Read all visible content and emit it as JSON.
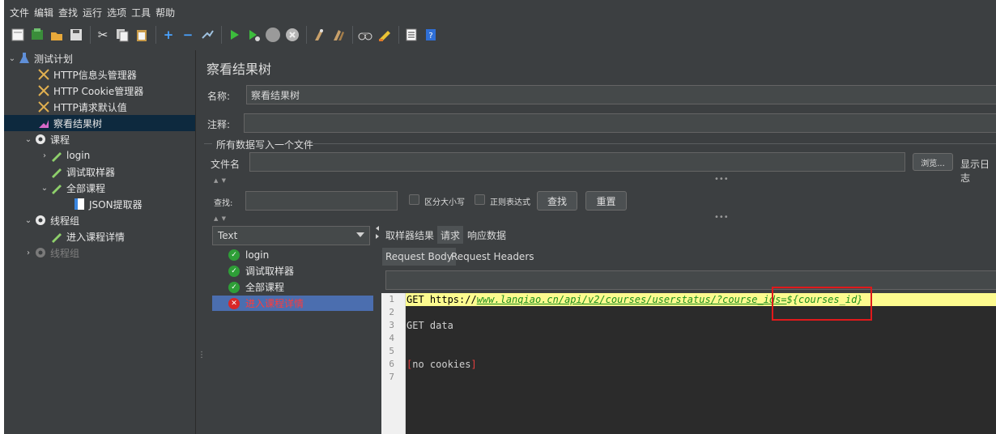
{
  "menubar": [
    "文件",
    "编辑",
    "查找",
    "运行",
    "选项",
    "工具",
    "帮助"
  ],
  "tree": {
    "root": "测试计划",
    "items": [
      {
        "label": "HTTP信息头管理器"
      },
      {
        "label": "HTTP Cookie管理器"
      },
      {
        "label": "HTTP请求默认值"
      },
      {
        "label": "察看结果树"
      },
      {
        "label": "课程"
      },
      {
        "label": "login"
      },
      {
        "label": "调试取样器"
      },
      {
        "label": "全部课程"
      },
      {
        "label": "JSON提取器"
      },
      {
        "label": "线程组"
      },
      {
        "label": "进入课程详情"
      },
      {
        "label": "线程组"
      }
    ]
  },
  "panel": {
    "title": "察看结果树",
    "name_label": "名称:",
    "name_value": "察看结果树",
    "comment_label": "注释:",
    "comment_value": "",
    "log_group_title": "所有数据写入一个文件",
    "filename_label": "文件名",
    "filename_value": "",
    "browse_label": "浏览...",
    "show_log_label": "显示日志",
    "search_label": "查找:",
    "search_value": "",
    "case_label": "区分大小写",
    "regex_label": "正则表达式",
    "find_button": "查找",
    "reset_button": "重置"
  },
  "results": {
    "renderer": "Text",
    "items": [
      {
        "label": "login",
        "status": "ok"
      },
      {
        "label": "调试取样器",
        "status": "ok"
      },
      {
        "label": "全部课程",
        "status": "ok"
      },
      {
        "label": "进入课程详情",
        "status": "fail"
      }
    ]
  },
  "tabs": {
    "main": [
      "取样器结果",
      "请求",
      "响应数据"
    ],
    "active_main": "请求",
    "sub": [
      "Request Body",
      "Request Headers"
    ],
    "active_sub": "Request Body"
  },
  "code": {
    "line_numbers": [
      "1",
      "2",
      "3",
      "4",
      "5",
      "6",
      "7"
    ],
    "line1_prefix": "GET https://",
    "line1_url": "www.lanqiao.cn/api/v2/courses/userstatus/?course_ids=",
    "line1_var": "${courses_id}",
    "line3": "GET data",
    "line6_open": "[",
    "line6_text": "no cookies",
    "line6_close": "]"
  },
  "colors": {
    "background": "#3c3f41",
    "selection": "#4b6eaf",
    "fail": "#ff3b3b",
    "ok": "#2e9e37",
    "highlight_line": "#fdfb8f",
    "annotation_box": "#e0191b"
  }
}
